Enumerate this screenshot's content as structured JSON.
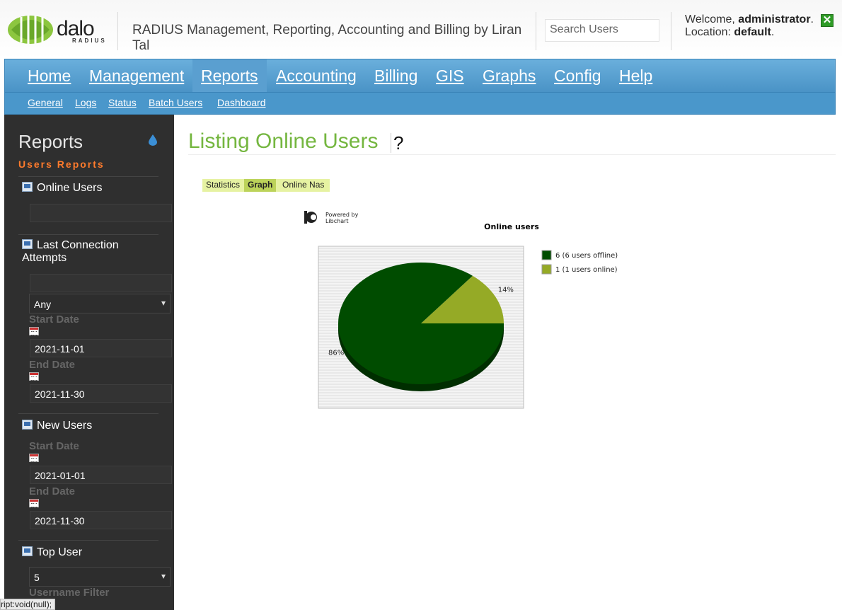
{
  "header": {
    "logo_text": "dalo",
    "logo_sub": "RADIUS",
    "title": "RADIUS Management, Reporting, Accounting and Billing by Liran Tal",
    "search_placeholder": "Search Users",
    "welcome_label": "Welcome,",
    "welcome_user": "administrator",
    "location_label": "Location:",
    "location_value": "default"
  },
  "nav": {
    "items": [
      "Home",
      "Management",
      "Reports",
      "Accounting",
      "Billing",
      "GIS",
      "Graphs",
      "Config",
      "Help"
    ],
    "active": "Reports",
    "sub_items": [
      "General",
      "Logs",
      "Status",
      "Batch Users",
      "Dashboard"
    ]
  },
  "sidebar": {
    "title": "Reports",
    "subtitle": "Users Reports",
    "online_users": {
      "label": "Online Users",
      "filter_value": ""
    },
    "last_connection": {
      "label": "Last Connection Attempts",
      "username_value": "",
      "select_value": "Any",
      "start_label": "Start Date",
      "start_value": "2021-11-01",
      "end_label": "End Date",
      "end_value": "2021-11-30"
    },
    "new_users": {
      "label": "New Users",
      "start_label": "Start Date",
      "start_value": "2021-01-01",
      "end_label": "End Date",
      "end_value": "2021-11-30"
    },
    "top_user": {
      "label": "Top User",
      "select_value": "5",
      "filter_label": "Username Filter"
    }
  },
  "statusbar": {
    "text": "ript:void(null);"
  },
  "main": {
    "title": "Listing Online Users",
    "tabs": [
      "Statistics",
      "Graph",
      "Online Nas"
    ],
    "active_tab": "Graph"
  },
  "chart_data": {
    "type": "pie",
    "title": "Online users",
    "powered_by": "Powered by",
    "powered_name": "Libchart",
    "slices": [
      {
        "label": "6 (6 users offline)",
        "value": 6,
        "percent_label": "86%",
        "color": "#004c00"
      },
      {
        "label": "1 (1 users online)",
        "value": 1,
        "percent_label": "14%",
        "color": "#95aa26"
      }
    ],
    "legend_position": "right"
  },
  "colors": {
    "accent_green": "#74b63f",
    "nav_blue": "#4a93c6",
    "sidebar_bg": "#2f2f2f",
    "subtitle_orange": "#ff7b2c"
  }
}
